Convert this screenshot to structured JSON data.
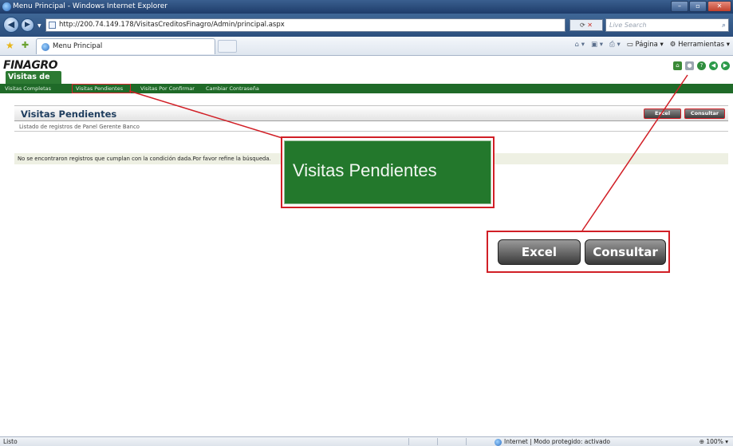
{
  "window": {
    "title": "Menu Principal - Windows Internet Explorer",
    "url": "http://200.74.149.178/VisitasCreditosFinagro/Admin/principal.aspx",
    "search_placeholder": "Live Search",
    "tab_title": "Menu Principal",
    "cmd_page": "Página",
    "cmd_tools": "Herramientas"
  },
  "app": {
    "brand": "FINAGRO",
    "module_tab": "Visitas de Crédito",
    "menu": [
      {
        "label": "Visitas Completas"
      },
      {
        "label": "Visitas Pendientes"
      },
      {
        "label": "Visitas Por Confirmar"
      },
      {
        "label": "Cambiar Contraseña"
      }
    ]
  },
  "section": {
    "title": "Visitas Pendientes",
    "subtitle": "Listado de registros de Panel Gerente Banco",
    "excel_label": "Excel",
    "consultar_label": "Consultar",
    "notice": "No se encontraron registros que cumplan con la condición dada.Por favor refine la búsqueda."
  },
  "callouts": {
    "menu_zoom_label": "Visitas Pendientes",
    "excel_label": "Excel",
    "consultar_label": "Consultar",
    "highlight_color": "#d11f26"
  },
  "status": {
    "text": "Listo",
    "zone": "Internet | Modo protegido: activado",
    "zoom": "100%"
  },
  "colors": {
    "brand_green": "#1f6a28",
    "tab_green": "#2d7a33",
    "ie_blue": "#2b4e7d"
  }
}
